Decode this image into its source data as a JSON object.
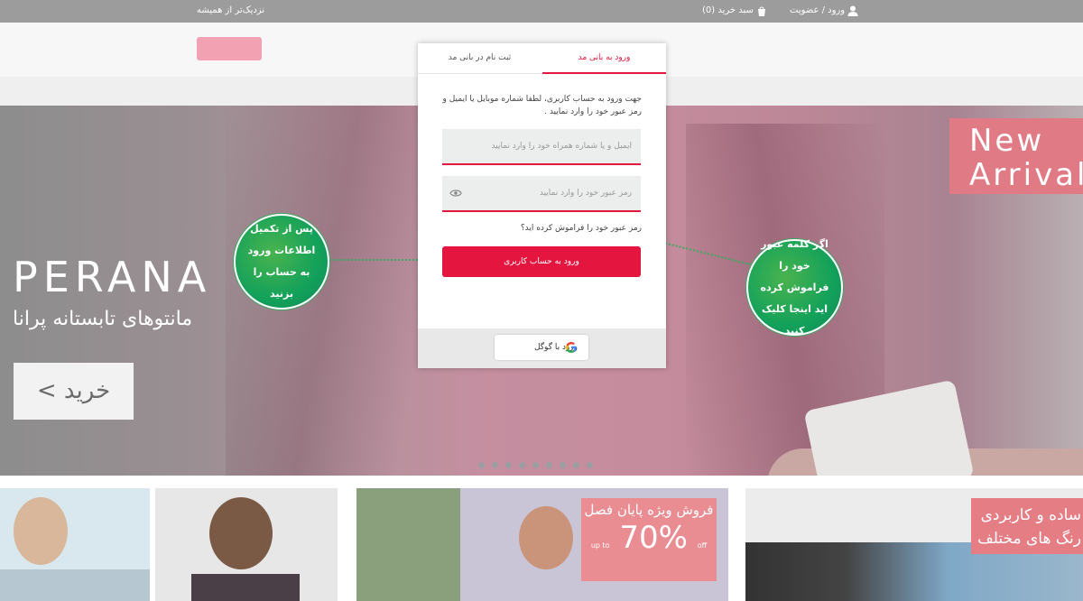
{
  "topbar": {
    "tagline": "نزدیک‌تر از همیشه",
    "cart": "سبد خرید (0)",
    "login": "ورود / عضویت"
  },
  "hero": {
    "brand": "PERANA",
    "subtitle": "مانتوهای تابستانه پرانا",
    "buy_button": "خرید >",
    "new_arrival_line1": "New",
    "new_arrival_line2": "Arrival"
  },
  "modal": {
    "tab_login": "ورود به بانی مد",
    "tab_register": "ثبت نام در بانی مد",
    "intro": "جهت ورود به حساب کاربری، لطفا شماره موبایل یا ایمیل و رمز عبور خود را وارد نمایید .",
    "email_placeholder": "ایمیل و یا شماره همراه خود را وارد نمایید",
    "password_placeholder": "رمز عبور خود را وارد نمایید",
    "forgot": "رمز عبور خود را فراموش کرده اید؟",
    "submit": "ورود به حساب کاربری",
    "google": "ورود با گوگل"
  },
  "callouts": {
    "left": "پس از تکمیل اطلاعات ورود به حساب را بزنید",
    "right": "اگر کلمه عبور خود را فراموش کرده اید اینجا کلیک کنید"
  },
  "promos": {
    "sale_title": "فروش ویژه پایان فصل",
    "sale_value": "70%",
    "sale_prefix": "up to",
    "sale_suffix": "off",
    "colors_line1": "ساده و کاربردی",
    "colors_line2": "رنگ های مختلف"
  },
  "colors": {
    "accent": "#e4163f",
    "callout": "#13a15a"
  }
}
